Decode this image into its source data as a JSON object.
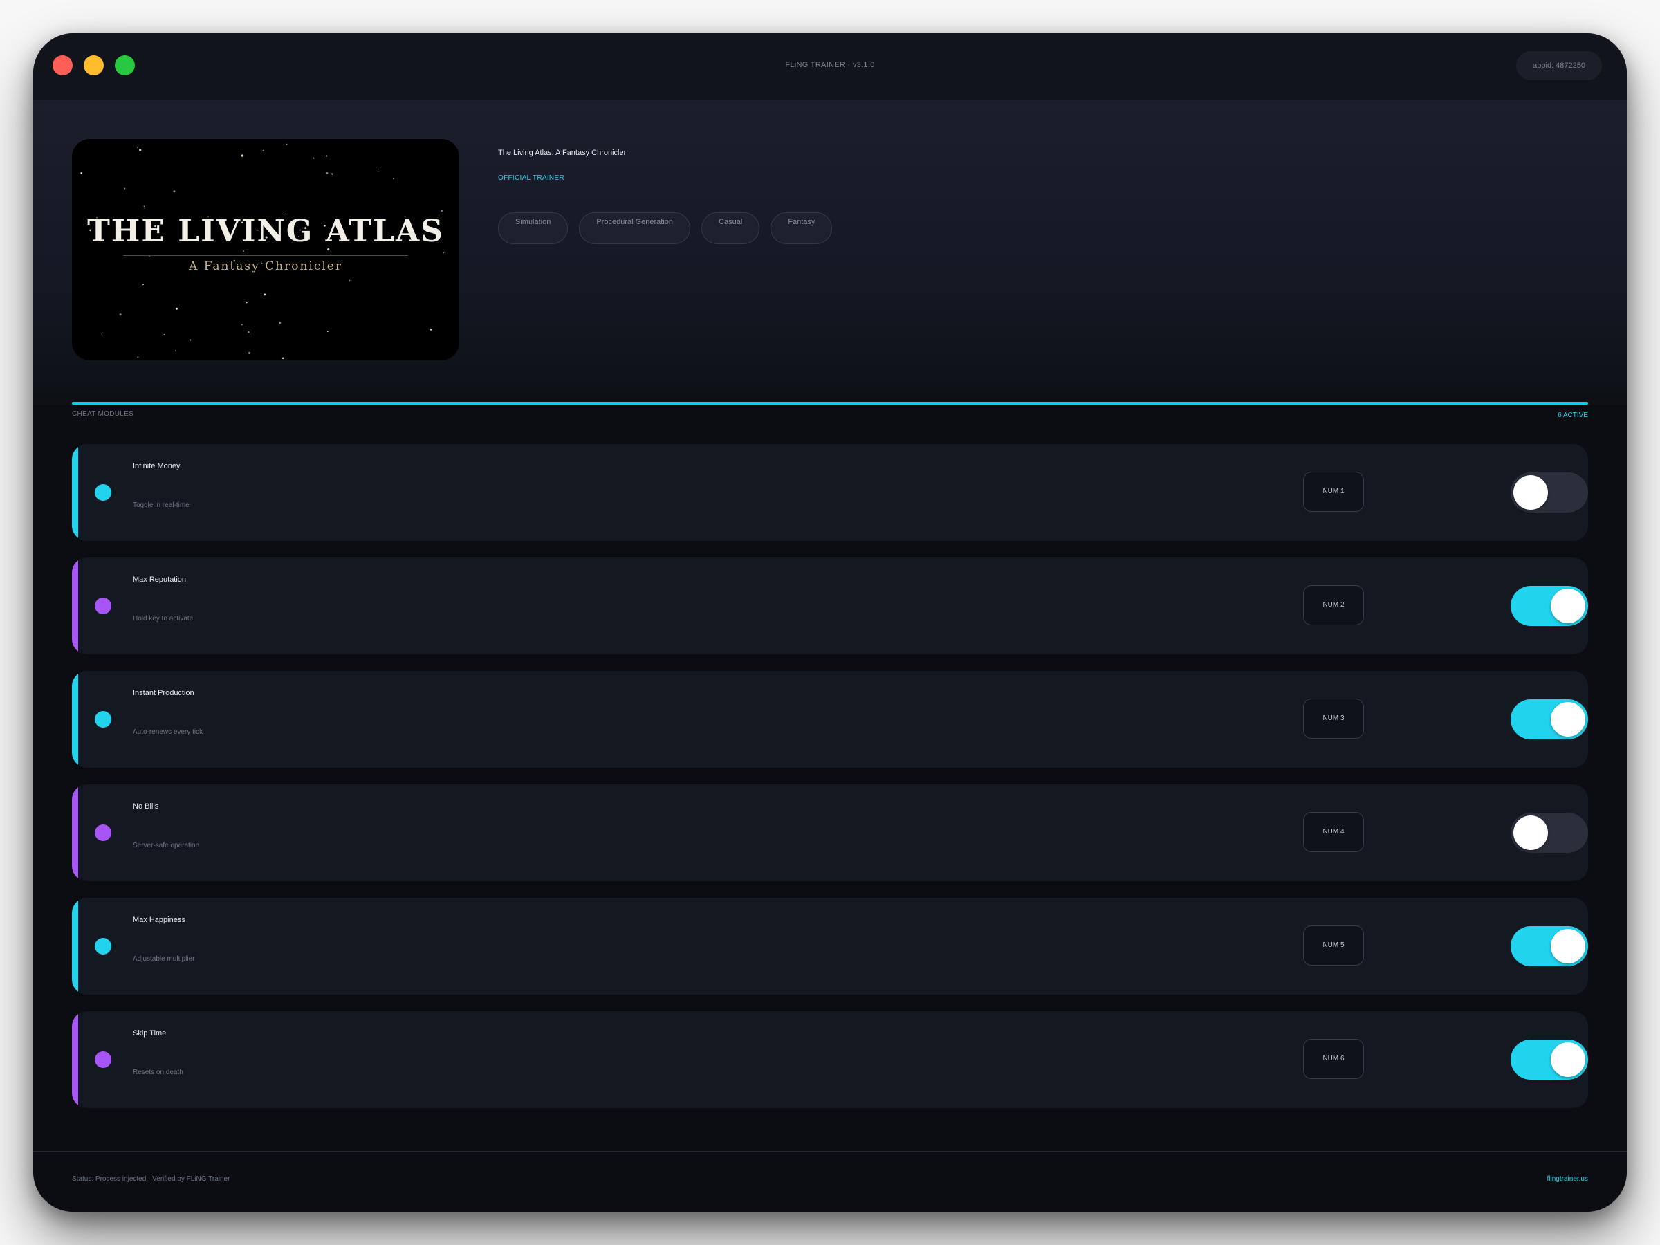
{
  "window": {
    "title": "FLiNG TRAINER · v3.1.0",
    "appid": "appid: 4872250"
  },
  "game": {
    "cover_title": "THE LIVING ATLAS",
    "cover_subtitle": "A Fantasy Chronicler",
    "title": "The Living Atlas: A Fantasy Chronicler",
    "badge": "OFFICIAL TRAINER",
    "tags": [
      "Simulation",
      "Procedural Generation",
      "Casual",
      "Fantasy"
    ]
  },
  "modules": {
    "label": "CHEAT MODULES",
    "active_count": "6 ACTIVE",
    "items": [
      {
        "name": "Infinite Money",
        "desc": "Toggle in real-time",
        "key": "NUM 1",
        "on": false,
        "accent": "#22d3ee"
      },
      {
        "name": "Max Reputation",
        "desc": "Hold key to activate",
        "key": "NUM 2",
        "on": true,
        "accent": "#a855f7"
      },
      {
        "name": "Instant Production",
        "desc": "Auto-renews every tick",
        "key": "NUM 3",
        "on": true,
        "accent": "#22d3ee"
      },
      {
        "name": "No Bills",
        "desc": "Server-safe operation",
        "key": "NUM 4",
        "on": false,
        "accent": "#a855f7"
      },
      {
        "name": "Max Happiness",
        "desc": "Adjustable multiplier",
        "key": "NUM 5",
        "on": true,
        "accent": "#22d3ee"
      },
      {
        "name": "Skip Time",
        "desc": "Resets on death",
        "key": "NUM 6",
        "on": true,
        "accent": "#a855f7"
      }
    ]
  },
  "footer": {
    "status": "Status: Process injected · Verified by FLiNG Trainer",
    "link": "flingtrainer.us"
  },
  "colors": {
    "accent_cyan": "#22d3ee",
    "accent_purple": "#a855f7",
    "background": "#0b0d12"
  }
}
